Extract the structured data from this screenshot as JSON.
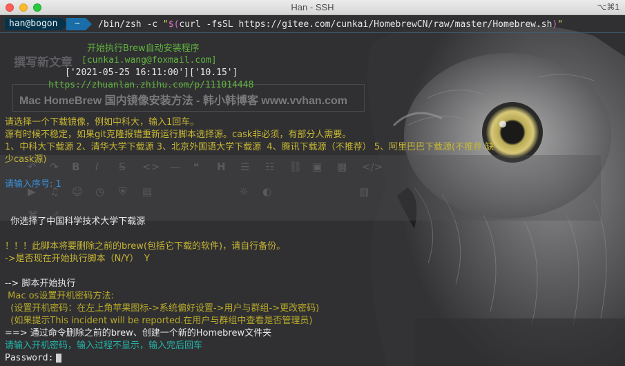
{
  "window": {
    "title": "Han - SSH",
    "shortcut": "⌥⌘1"
  },
  "prompt": {
    "user_host": "han@bogon",
    "directory": "~",
    "command_prefix": "/bin/zsh -c ",
    "command_quote_open": "\"",
    "command_sub": "$(",
    "command_body": "curl -fsSL https://gitee.com/cunkai/HomebrewCN/raw/master/Homebrew.sh",
    "command_sub_close": ")",
    "command_quote_close": "\""
  },
  "background_page": {
    "title": "撰写新文章",
    "heading": "Mac HomeBrew 国内镜像安装方法 - 韩小韩博客 www.vvhan.com"
  },
  "output": {
    "banner_title": "开始执行Brew自动安装程序",
    "banner_email": "[cunkai.wang@foxmail.com]",
    "banner_date": "['2021-05-25 16:11:00']['10.15']",
    "banner_url": "https://zhuanlan.zhihu.com/p/111014448",
    "mirror_prompt": "请选择一个下载镜像，例如中科大，输入1回车。",
    "mirror_note": "源有时候不稳定，如果git克隆报错重新运行脚本选择源。cask非必须，有部分人需要。",
    "mirror_options_1": "1、中科大下载源 2、清华大学下载源 3、北京外国语大学下载源  4、腾讯下载源（不推荐） 5、阿里巴巴下载源(不推荐 缺",
    "mirror_options_2": "少cask源)",
    "input_serial": "请输入序号: 1",
    "chosen": "  你选择了中国科学技术大学下载源",
    "warning_1": "！！！此脚本将要删除之前的brew(包括它下载的软件)，请自行备份。",
    "warning_2": "->是否现在开始执行脚本（N/Y）  Y",
    "start": "--> 脚本开始执行",
    "mac_pwd_title": " Mac os设置开机密码方法:",
    "mac_pwd_1": "  (设置开机密码：在左上角苹果图标->系统偏好设置->用户与群组->更改密码)",
    "mac_pwd_2": "  (如果提示This incident will be reported.在用户与群组中查看是否管理员)",
    "delete_old": "==> 通过命令删除之前的brew、创建一个新的Homebrew文件夹",
    "enter_pwd": "请输入开机密码，输入过程不显示，输入完后回车",
    "password_label": "Password:"
  }
}
